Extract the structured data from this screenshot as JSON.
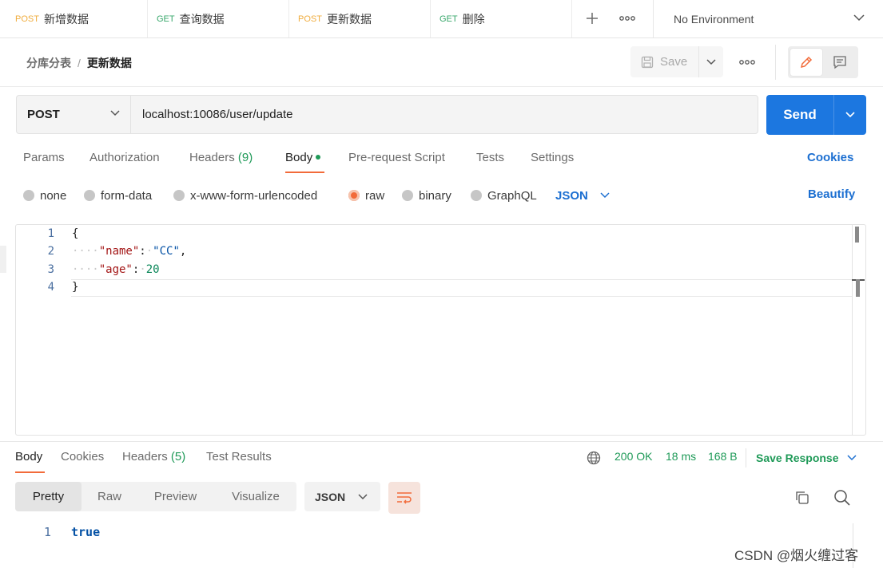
{
  "tabs": [
    {
      "method": "POST",
      "title": "新增数据"
    },
    {
      "method": "GET",
      "title": "查询数据"
    },
    {
      "method": "POST",
      "title": "更新数据"
    },
    {
      "method": "GET",
      "title": "删除"
    }
  ],
  "environment": {
    "label": "No Environment"
  },
  "breadcrumb": {
    "parent": "分库分表",
    "separator": "/",
    "current": "更新数据"
  },
  "toolbar": {
    "save_label": "Save"
  },
  "request": {
    "method": "POST",
    "url": "localhost:10086/user/update",
    "send_label": "Send"
  },
  "request_tabs": {
    "params": "Params",
    "authorization": "Authorization",
    "headers": "Headers",
    "headers_count": "(9)",
    "body": "Body",
    "prerequest": "Pre-request Script",
    "tests": "Tests",
    "settings": "Settings",
    "cookies": "Cookies"
  },
  "body_types": {
    "none": "none",
    "form_data": "form-data",
    "urlencoded": "x-www-form-urlencoded",
    "raw": "raw",
    "binary": "binary",
    "graphql": "GraphQL",
    "format": "JSON",
    "beautify": "Beautify"
  },
  "editor": {
    "line_numbers": [
      "1",
      "2",
      "3",
      "4"
    ],
    "open_brace": "{",
    "close_brace": "}",
    "indent": "····",
    "key1": "\"name\"",
    "value1": "\"CC\"",
    "key2": "\"age\"",
    "value2": "20",
    "colon": ":",
    "colon_space": "·",
    "comma": ","
  },
  "response_tabs": {
    "body": "Body",
    "cookies": "Cookies",
    "headers": "Headers",
    "headers_count": "(5)",
    "test_results": "Test Results"
  },
  "response_status": {
    "status": "200 OK",
    "time": "18 ms",
    "size": "168 B",
    "save_response": "Save Response"
  },
  "response_views": {
    "pretty": "Pretty",
    "raw": "Raw",
    "preview": "Preview",
    "visualize": "Visualize",
    "format": "JSON"
  },
  "response_body": {
    "line_number": "1",
    "value": "true"
  },
  "watermark": "CSDN @烟火缠过客",
  "colors": {
    "accent": "#f26b3a",
    "send": "#1c77e0",
    "link": "#1c6fd1",
    "success": "#1f9a58",
    "post": "#f0ad3f",
    "get": "#39a86c"
  }
}
